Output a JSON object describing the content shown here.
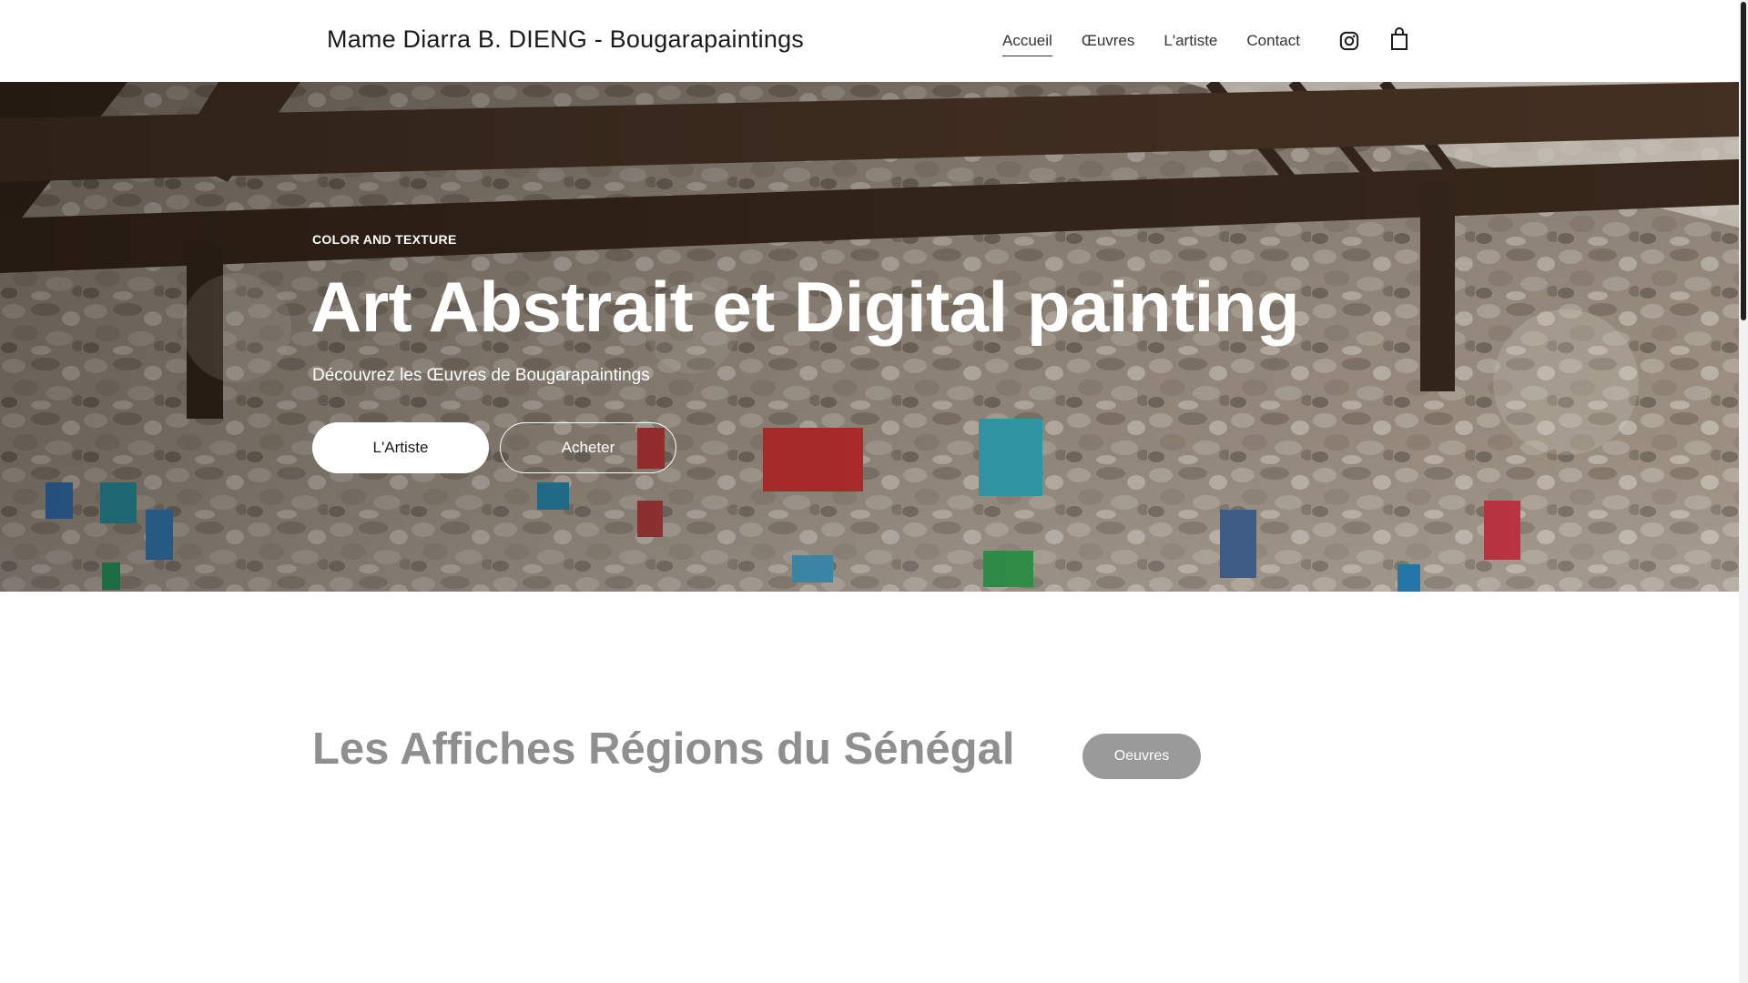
{
  "header": {
    "site_title": "Mame Diarra B. DIENG - Bougarapaintings",
    "nav": [
      {
        "label": "Accueil",
        "active": true
      },
      {
        "label": "Œuvres",
        "active": false
      },
      {
        "label": "L'artiste",
        "active": false
      },
      {
        "label": "Contact",
        "active": false
      }
    ],
    "icons": {
      "instagram": "instagram-icon",
      "cart": "shopping-bag-icon"
    }
  },
  "hero": {
    "eyebrow": "COLOR AND TEXTURE",
    "title": "Art Abstrait et Digital painting",
    "subtitle": "Découvrez les Œuvres de Bougarapaintings",
    "primary_button": "L'Artiste",
    "secondary_button": "Acheter"
  },
  "section": {
    "title": "Les Affiches Régions du Sénégal",
    "button": "Oeuvres"
  },
  "colors": {
    "text_dark": "#1b1b1b",
    "section_title": "#8f8f8f",
    "section_button": "#9a9a9a",
    "white": "#ffffff"
  }
}
